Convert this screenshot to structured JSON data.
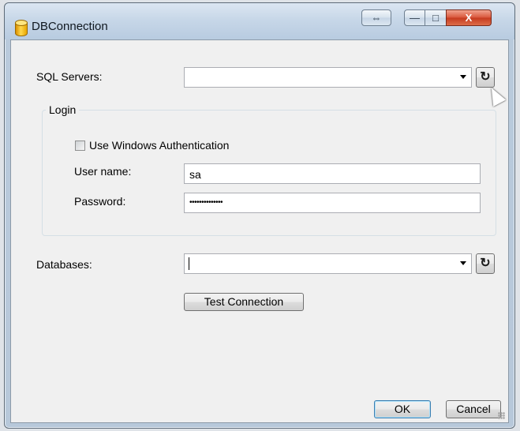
{
  "window": {
    "title": "DBConnection",
    "expand_glyph": "⇔",
    "minimize_glyph": "—",
    "maximize_glyph": "□",
    "close_glyph": "X"
  },
  "sql_servers": {
    "label": "SQL Servers:",
    "value": "",
    "refresh_icon": "refresh-icon"
  },
  "login": {
    "group_title": "Login",
    "windows_auth_label": "Use Windows Authentication",
    "windows_auth_checked": false,
    "username_label": "User name:",
    "username_value": "sa",
    "password_label": "Password:",
    "password_value": "••••••••••••••"
  },
  "databases": {
    "label": "Databases:",
    "value": ""
  },
  "buttons": {
    "test_connection": "Test Connection",
    "ok": "OK",
    "cancel": "Cancel",
    "refresh_glyph": "↻"
  }
}
